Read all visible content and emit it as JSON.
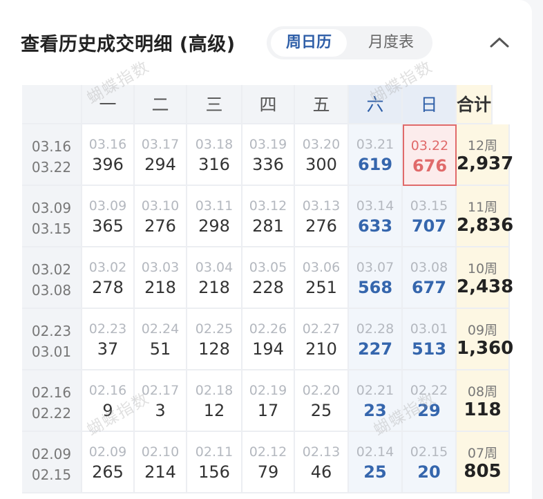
{
  "header": {
    "title": "查看历史成交明细 (高级)",
    "tabs": [
      {
        "label": "周日历",
        "active": true
      },
      {
        "label": "月度表",
        "active": false
      }
    ],
    "collapse_icon": "chevron-up-icon"
  },
  "table": {
    "columns": [
      "一",
      "二",
      "三",
      "四",
      "五",
      "六",
      "日",
      "合计"
    ],
    "rows": [
      {
        "range_start": "03.16",
        "range_end": "03.22",
        "week_label": "12周",
        "total": "2,937",
        "days": [
          {
            "date": "03.16",
            "value": "396"
          },
          {
            "date": "03.17",
            "value": "294"
          },
          {
            "date": "03.18",
            "value": "316"
          },
          {
            "date": "03.19",
            "value": "336"
          },
          {
            "date": "03.20",
            "value": "300"
          },
          {
            "date": "03.21",
            "value": "619"
          },
          {
            "date": "03.22",
            "value": "676"
          }
        ]
      },
      {
        "range_start": "03.09",
        "range_end": "03.15",
        "week_label": "11周",
        "total": "2,836",
        "days": [
          {
            "date": "03.09",
            "value": "365"
          },
          {
            "date": "03.10",
            "value": "276"
          },
          {
            "date": "03.11",
            "value": "298"
          },
          {
            "date": "03.12",
            "value": "281"
          },
          {
            "date": "03.13",
            "value": "276"
          },
          {
            "date": "03.14",
            "value": "633"
          },
          {
            "date": "03.15",
            "value": "707"
          }
        ]
      },
      {
        "range_start": "03.02",
        "range_end": "03.08",
        "week_label": "10周",
        "total": "2,438",
        "days": [
          {
            "date": "03.02",
            "value": "278"
          },
          {
            "date": "03.03",
            "value": "218"
          },
          {
            "date": "03.04",
            "value": "218"
          },
          {
            "date": "03.05",
            "value": "228"
          },
          {
            "date": "03.06",
            "value": "251"
          },
          {
            "date": "03.07",
            "value": "568"
          },
          {
            "date": "03.08",
            "value": "677"
          }
        ]
      },
      {
        "range_start": "02.23",
        "range_end": "03.01",
        "week_label": "09周",
        "total": "1,360",
        "days": [
          {
            "date": "02.23",
            "value": "37"
          },
          {
            "date": "02.24",
            "value": "51"
          },
          {
            "date": "02.25",
            "value": "128"
          },
          {
            "date": "02.26",
            "value": "194"
          },
          {
            "date": "02.27",
            "value": "210"
          },
          {
            "date": "02.28",
            "value": "227"
          },
          {
            "date": "03.01",
            "value": "513"
          }
        ]
      },
      {
        "range_start": "02.16",
        "range_end": "02.22",
        "week_label": "08周",
        "total": "118",
        "days": [
          {
            "date": "02.16",
            "value": "9"
          },
          {
            "date": "02.17",
            "value": "3"
          },
          {
            "date": "02.18",
            "value": "12"
          },
          {
            "date": "02.19",
            "value": "17"
          },
          {
            "date": "02.20",
            "value": "25"
          },
          {
            "date": "02.21",
            "value": "23"
          },
          {
            "date": "02.22",
            "value": "29"
          }
        ]
      },
      {
        "range_start": "02.09",
        "range_end": "02.15",
        "week_label": "07周",
        "total": "805",
        "days": [
          {
            "date": "02.09",
            "value": "265"
          },
          {
            "date": "02.10",
            "value": "214"
          },
          {
            "date": "02.11",
            "value": "156"
          },
          {
            "date": "02.12",
            "value": "79"
          },
          {
            "date": "02.13",
            "value": "46"
          },
          {
            "date": "02.14",
            "value": "25"
          },
          {
            "date": "02.15",
            "value": "20"
          }
        ]
      }
    ],
    "highlight_date": "03.22"
  },
  "watermark": "蝴蝶指数",
  "colors": {
    "accent_blue": "#2f5fa8",
    "highlight_red": "#e06a6a",
    "total_bg": "#fdf7e3"
  }
}
